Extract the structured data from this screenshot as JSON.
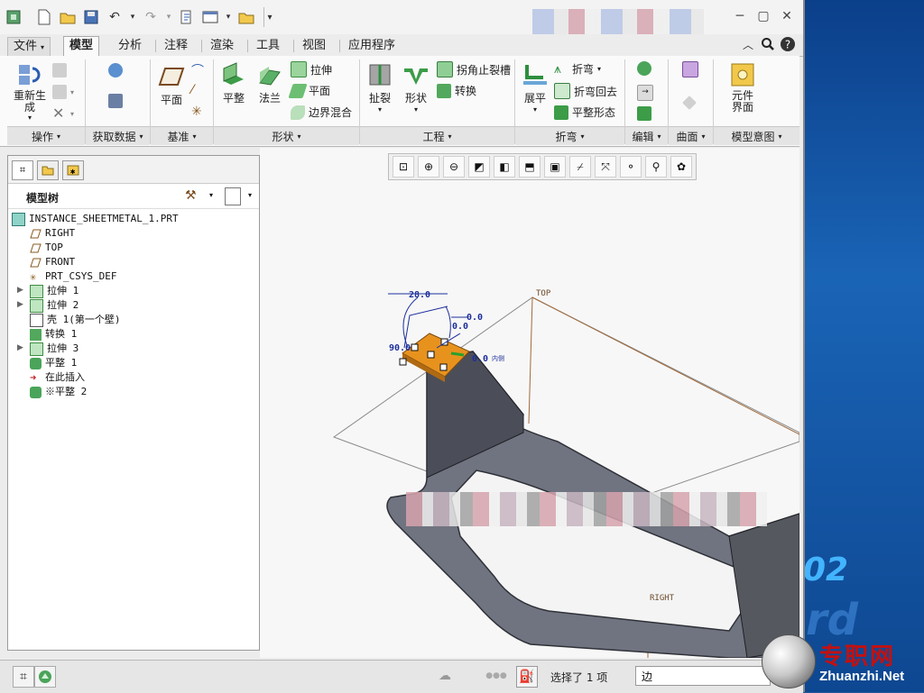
{
  "quick_access": {
    "icons": [
      "app-icon",
      "new-icon",
      "open-icon",
      "save-icon",
      "undo-icon",
      "redo-icon",
      "regenerate-icon",
      "windows-icon",
      "folder-icon"
    ]
  },
  "tabs": [
    {
      "label": "文件"
    },
    {
      "label": "模型"
    },
    {
      "label": "分析"
    },
    {
      "label": "注释"
    },
    {
      "label": "渲染"
    },
    {
      "label": "工具"
    },
    {
      "label": "视图"
    },
    {
      "label": "应用程序"
    }
  ],
  "ribbon": {
    "operations": {
      "regenerate": "重新生成",
      "group": "操作"
    },
    "get_data": {
      "group": "获取数据"
    },
    "datum": {
      "plane": "平面",
      "group": "基准"
    },
    "shapes": {
      "flat": "平整",
      "flange": "法兰",
      "extrude": "拉伸",
      "plane": "平面",
      "blend": "边界混合",
      "group": "形状"
    },
    "engineering": {
      "rip": "扯裂",
      "form": "形状",
      "corner_relief": "拐角止裂槽",
      "convert": "转换",
      "group": "工程"
    },
    "bends": {
      "unbend": "展平",
      "bend": "折弯",
      "bend_back": "折弯回去",
      "flatten": "平整形态",
      "group": "折弯"
    },
    "editing": {
      "group": "编辑"
    },
    "surfaces": {
      "group": "曲面"
    },
    "model_intent": {
      "component_interface": "元件界面",
      "group": "模型意图"
    }
  },
  "model_tree": {
    "title": "模型树",
    "items": [
      {
        "label": "INSTANCE_SHEETMETAL_1.PRT",
        "icon": "part-icon",
        "expandable": false
      },
      {
        "label": "RIGHT",
        "icon": "datum-plane-icon",
        "expandable": false
      },
      {
        "label": "TOP",
        "icon": "datum-plane-icon",
        "expandable": false
      },
      {
        "label": "FRONT",
        "icon": "datum-plane-icon",
        "expandable": false
      },
      {
        "label": "PRT_CSYS_DEF",
        "icon": "csys-icon",
        "expandable": false
      },
      {
        "label": "拉伸 1",
        "icon": "extrude-icon",
        "expandable": true
      },
      {
        "label": "拉伸 2",
        "icon": "extrude-icon",
        "expandable": true
      },
      {
        "label": "壳 1(第一个壁)",
        "icon": "shell-icon",
        "expandable": false
      },
      {
        "label": "转换 1",
        "icon": "convert-icon",
        "expandable": false
      },
      {
        "label": "拉伸 3",
        "icon": "extrude-icon",
        "expandable": true
      },
      {
        "label": "平整 1",
        "icon": "flat-wall-icon",
        "expandable": false
      },
      {
        "label": "在此插入",
        "icon": "insert-arrow-icon",
        "expandable": false
      },
      {
        "label": "※平整 2",
        "icon": "flat-wall-icon",
        "expandable": false
      }
    ]
  },
  "viewport": {
    "datum_labels": {
      "top": "TOP",
      "right": "RIGHT"
    },
    "dimensions": {
      "length": "28.0",
      "angle": "90.0",
      "offset1": "0.0",
      "offset2": "0.0",
      "offset3": "0.0",
      "inside_label": "内侧"
    }
  },
  "status": {
    "selection": "选择了 1 项",
    "filter": "边"
  },
  "watermark": {
    "cn": "专职网",
    "en": "Zhuanzhi.Net"
  },
  "desktop_deco": {
    "number": "02",
    "letters": "rd"
  }
}
